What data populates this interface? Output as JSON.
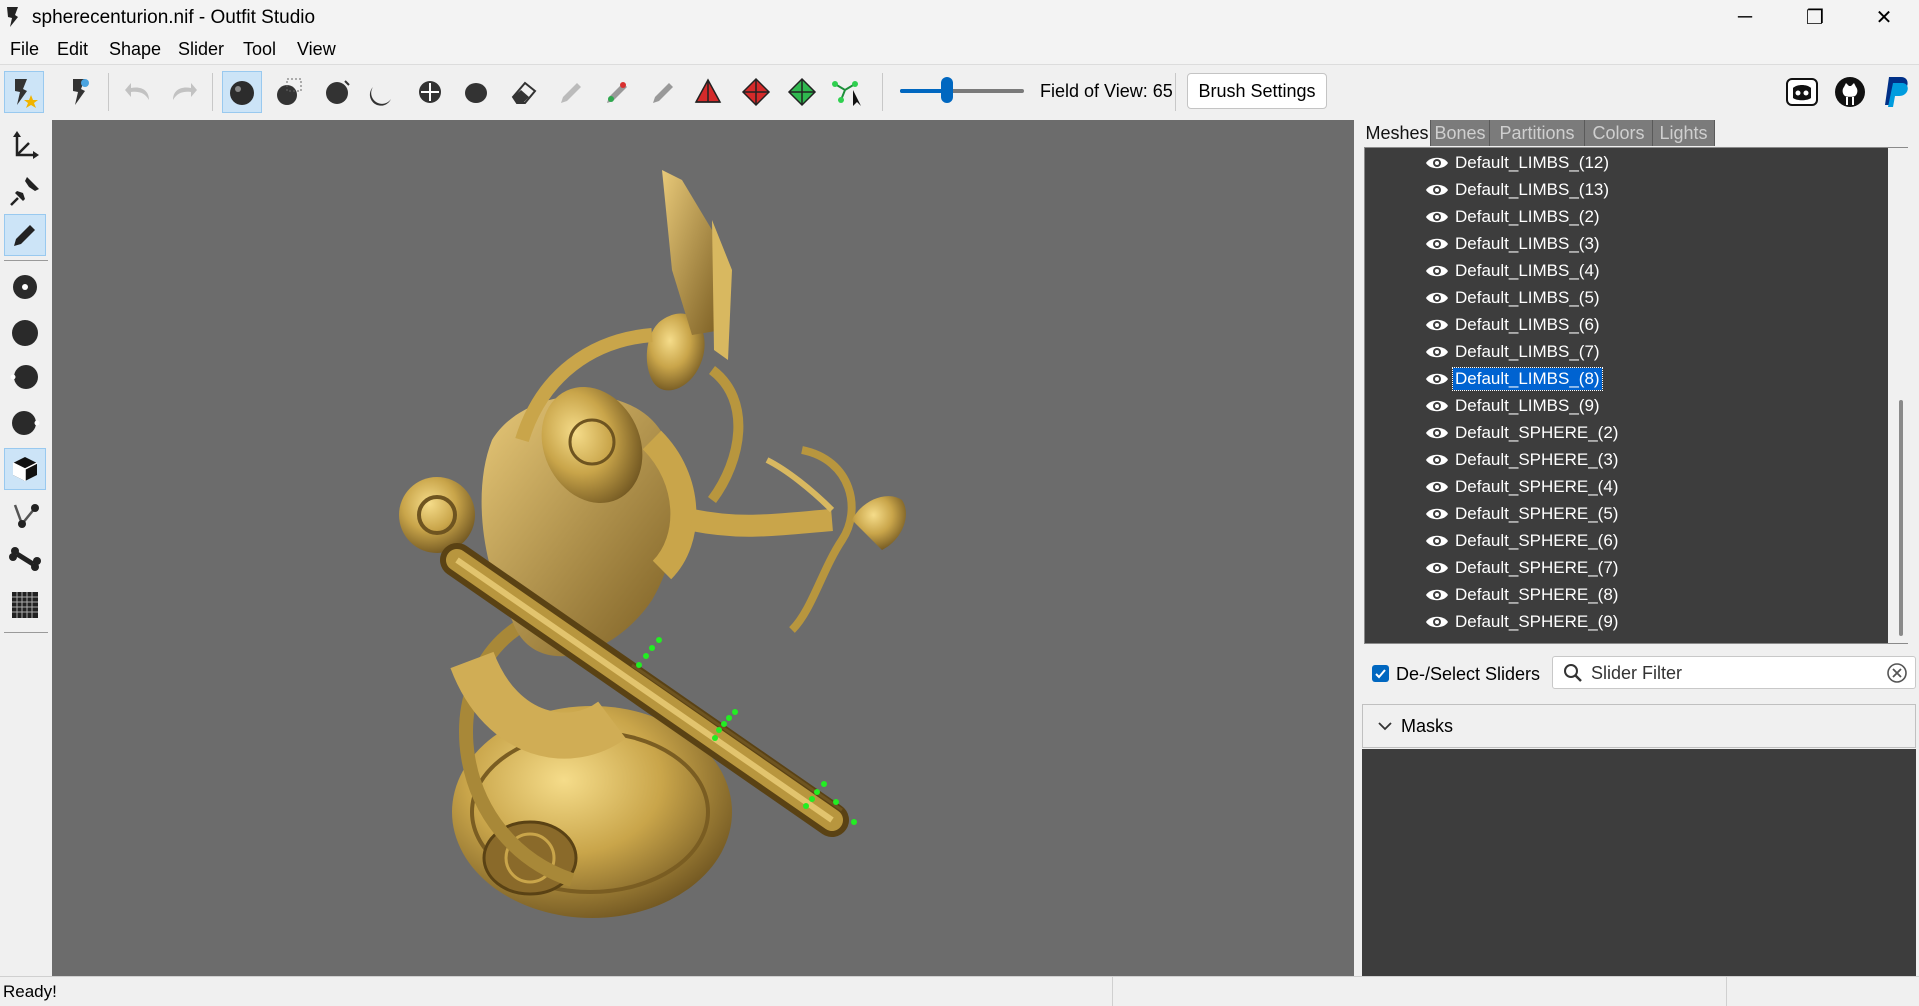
{
  "window": {
    "title": "spherecenturion.nif - Outfit Studio",
    "minimize_glyph": "─",
    "restore_glyph": "❐",
    "close_glyph": "✕"
  },
  "menu": [
    "File",
    "Edit",
    "Shape",
    "Slider",
    "Tool",
    "View"
  ],
  "toolbar": {
    "fov_label": "Field of View: 65",
    "fov_value": 65,
    "fov_slider_fraction": 0.38,
    "brush_settings_label": "Brush Settings",
    "icons": [
      "outfit-star-icon",
      "skeleton-icon",
      "undo-icon",
      "redo-icon",
      "select-brush-icon",
      "mask-rect-icon",
      "inflate-brush-icon",
      "deflate-brush-icon",
      "move-brush-icon",
      "smooth-brush-icon",
      "eraser-icon",
      "weight-brush-icon",
      "color-brush-icon",
      "alpha-brush-icon",
      "transform-icon",
      "pivot-icon",
      "vertex-select-icon",
      "vertex-edit-icon"
    ],
    "social_icons": [
      "discord-icon",
      "github-icon",
      "paypal-icon"
    ]
  },
  "left_tools": [
    "transform-tool-icon",
    "pivot-tool-icon",
    "pencil-tool-icon",
    "vertex-select-icon",
    "sphere-icon",
    "sphere-left-icon",
    "sphere-right-icon",
    "cube-icon",
    "edge-icon",
    "bone-icon",
    "grid-icon"
  ],
  "tabs": [
    "Meshes",
    "Bones",
    "Partitions",
    "Colors",
    "Lights"
  ],
  "active_tab": "Meshes",
  "meshes": [
    {
      "label": "Default_LIMBS_(12)",
      "selected": false
    },
    {
      "label": "Default_LIMBS_(13)",
      "selected": false
    },
    {
      "label": "Default_LIMBS_(2)",
      "selected": false
    },
    {
      "label": "Default_LIMBS_(3)",
      "selected": false
    },
    {
      "label": "Default_LIMBS_(4)",
      "selected": false
    },
    {
      "label": "Default_LIMBS_(5)",
      "selected": false
    },
    {
      "label": "Default_LIMBS_(6)",
      "selected": false
    },
    {
      "label": "Default_LIMBS_(7)",
      "selected": false
    },
    {
      "label": "Default_LIMBS_(8)",
      "selected": true
    },
    {
      "label": "Default_LIMBS_(9)",
      "selected": false
    },
    {
      "label": "Default_SPHERE_(2)",
      "selected": false
    },
    {
      "label": "Default_SPHERE_(3)",
      "selected": false
    },
    {
      "label": "Default_SPHERE_(4)",
      "selected": false
    },
    {
      "label": "Default_SPHERE_(5)",
      "selected": false
    },
    {
      "label": "Default_SPHERE_(6)",
      "selected": false
    },
    {
      "label": "Default_SPHERE_(7)",
      "selected": false
    },
    {
      "label": "Default_SPHERE_(8)",
      "selected": false
    },
    {
      "label": "Default_SPHERE_(9)",
      "selected": false
    }
  ],
  "sliders": {
    "deselect_label": "De-/Select Sliders",
    "deselect_checked": true,
    "filter_placeholder": "Slider Filter",
    "masks_label": "Masks"
  },
  "status": {
    "text": "Ready!"
  },
  "colors": {
    "accent": "#0067c0",
    "viewport_bg": "#6c6c6c",
    "list_bg": "#3d3d3d",
    "model_gold": "#c9a54a",
    "vertex_green": "#22ee22"
  }
}
